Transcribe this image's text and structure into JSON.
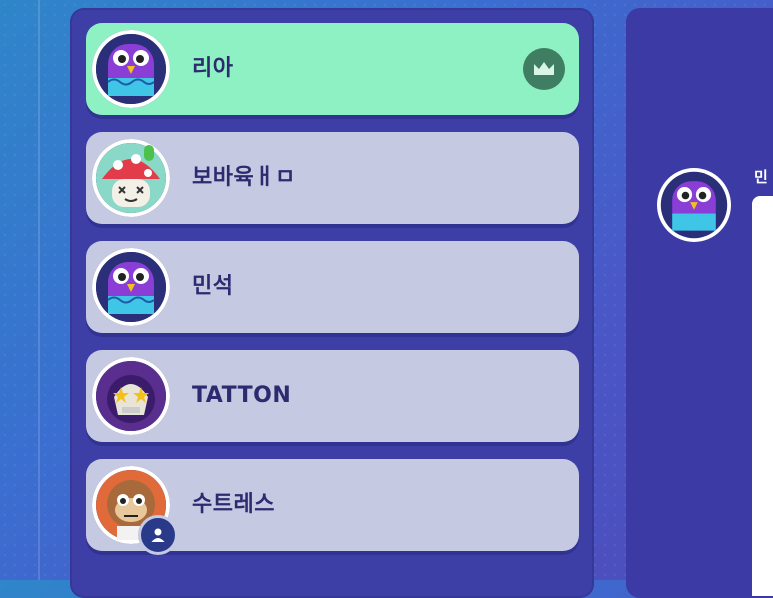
{
  "players": [
    {
      "name": "리아",
      "avatar": "purple-bird-icon",
      "host": true,
      "active": true
    },
    {
      "name": "보바육ㅐㅁ",
      "avatar": "mushroom-icon",
      "host": false,
      "active": false
    },
    {
      "name": "민석",
      "avatar": "purple-bird-icon",
      "host": false,
      "active": false
    },
    {
      "name": "TATTON",
      "avatar": "skull-star-glasses-icon",
      "host": false,
      "active": false
    },
    {
      "name": "수트레스",
      "avatar": "astronaut-monkey-icon",
      "host": false,
      "active": false,
      "self": true
    }
  ],
  "chat": {
    "sender": "민"
  },
  "colors": {
    "active_row": "#8ef1c4",
    "row": "#c6c9e2",
    "panel": "#3d3fa6",
    "name_text": "#2e2a6f"
  }
}
